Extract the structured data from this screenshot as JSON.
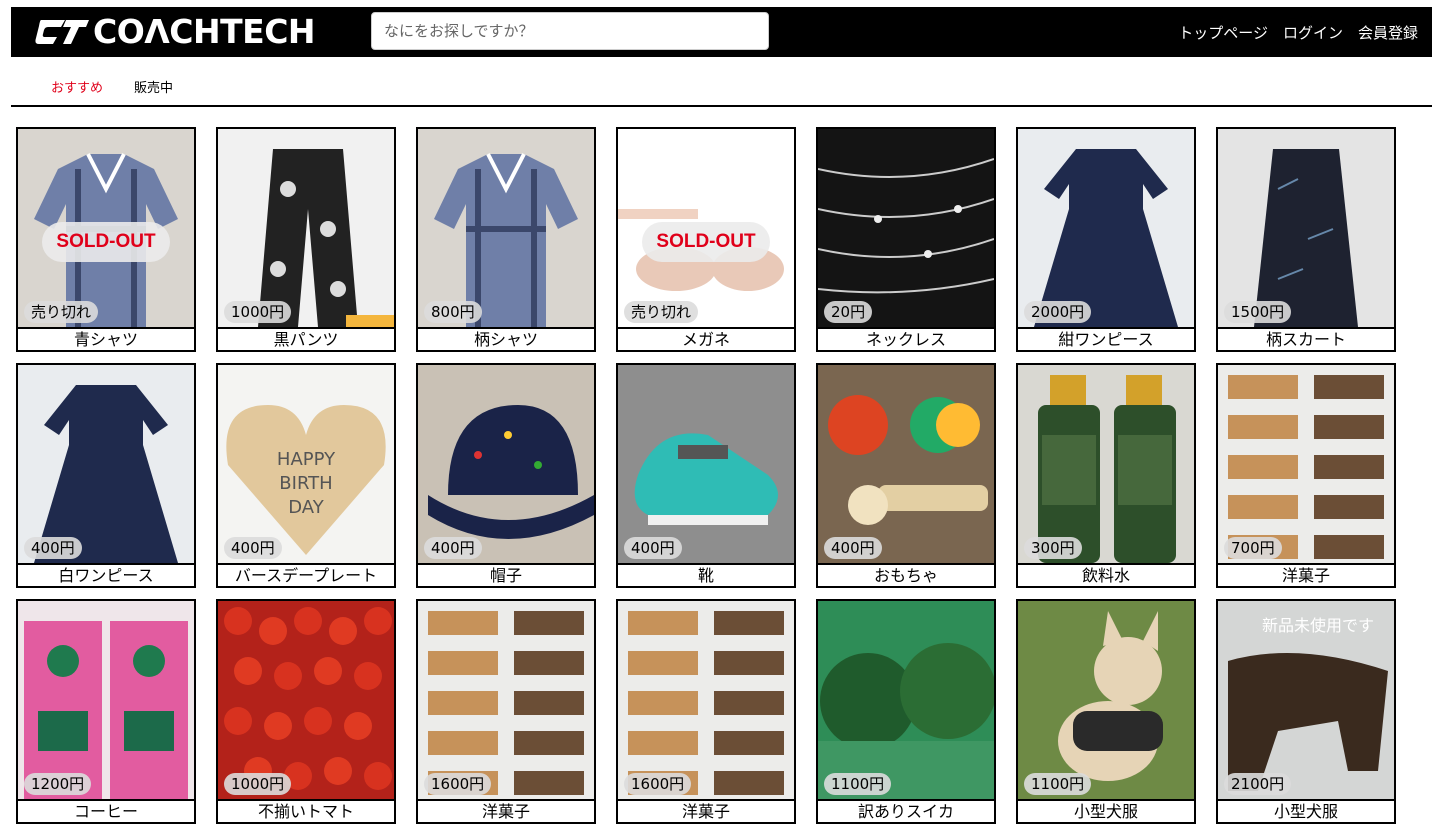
{
  "header": {
    "logo_text": "COΛCHTECH",
    "search_placeholder": "なにをお探しですか？",
    "links": [
      "トップページ",
      "ログイン",
      "会員登録"
    ]
  },
  "tabs": {
    "recommended": "おすすめ",
    "on_sale": "販売中",
    "active_color": "#e0001a"
  },
  "products": [
    {
      "name": "青シャツ",
      "price": "売り切れ",
      "sold_label": "SOLD-OUT",
      "icon": "shirt-icon"
    },
    {
      "name": "黒パンツ",
      "price": "1000円",
      "icon": "pants-icon"
    },
    {
      "name": "柄シャツ",
      "price": "800円",
      "icon": "shirt-icon"
    },
    {
      "name": "メガネ",
      "price": "売り切れ",
      "sold_label": "SOLD-OUT",
      "icon": "glasses-icon"
    },
    {
      "name": "ネックレス",
      "price": "20円",
      "icon": "necklace-icon"
    },
    {
      "name": "紺ワンピース",
      "price": "2000円",
      "icon": "dress-icon"
    },
    {
      "name": "柄スカート",
      "price": "1500円",
      "icon": "skirt-icon"
    },
    {
      "name": "白ワンピース",
      "price": "400円",
      "icon": "dress-icon"
    },
    {
      "name": "バースデープレート",
      "price": "400円",
      "icon": "plate-icon"
    },
    {
      "name": "帽子",
      "price": "400円",
      "icon": "hat-icon"
    },
    {
      "name": "靴",
      "price": "400円",
      "icon": "shoe-icon"
    },
    {
      "name": "おもちゃ",
      "price": "400円",
      "icon": "toy-icon"
    },
    {
      "name": "飲料水",
      "price": "300円",
      "icon": "bottle-icon"
    },
    {
      "name": "洋菓子",
      "price": "700円",
      "icon": "sweets-icon"
    },
    {
      "name": "コーヒー",
      "price": "1200円",
      "icon": "coffee-icon"
    },
    {
      "name": "不揃いトマト",
      "price": "1000円",
      "icon": "tomato-icon"
    },
    {
      "name": "洋菓子",
      "price": "1600円",
      "icon": "sweets-icon"
    },
    {
      "name": "洋菓子",
      "price": "1600円",
      "icon": "sweets-icon"
    },
    {
      "name": "訳ありスイカ",
      "price": "1100円",
      "icon": "watermelon-icon"
    },
    {
      "name": "小型犬服",
      "price": "1100円",
      "icon": "dog-icon"
    },
    {
      "name": "小型犬服",
      "price": "2100円",
      "icon": "dog-clothes-icon"
    }
  ]
}
